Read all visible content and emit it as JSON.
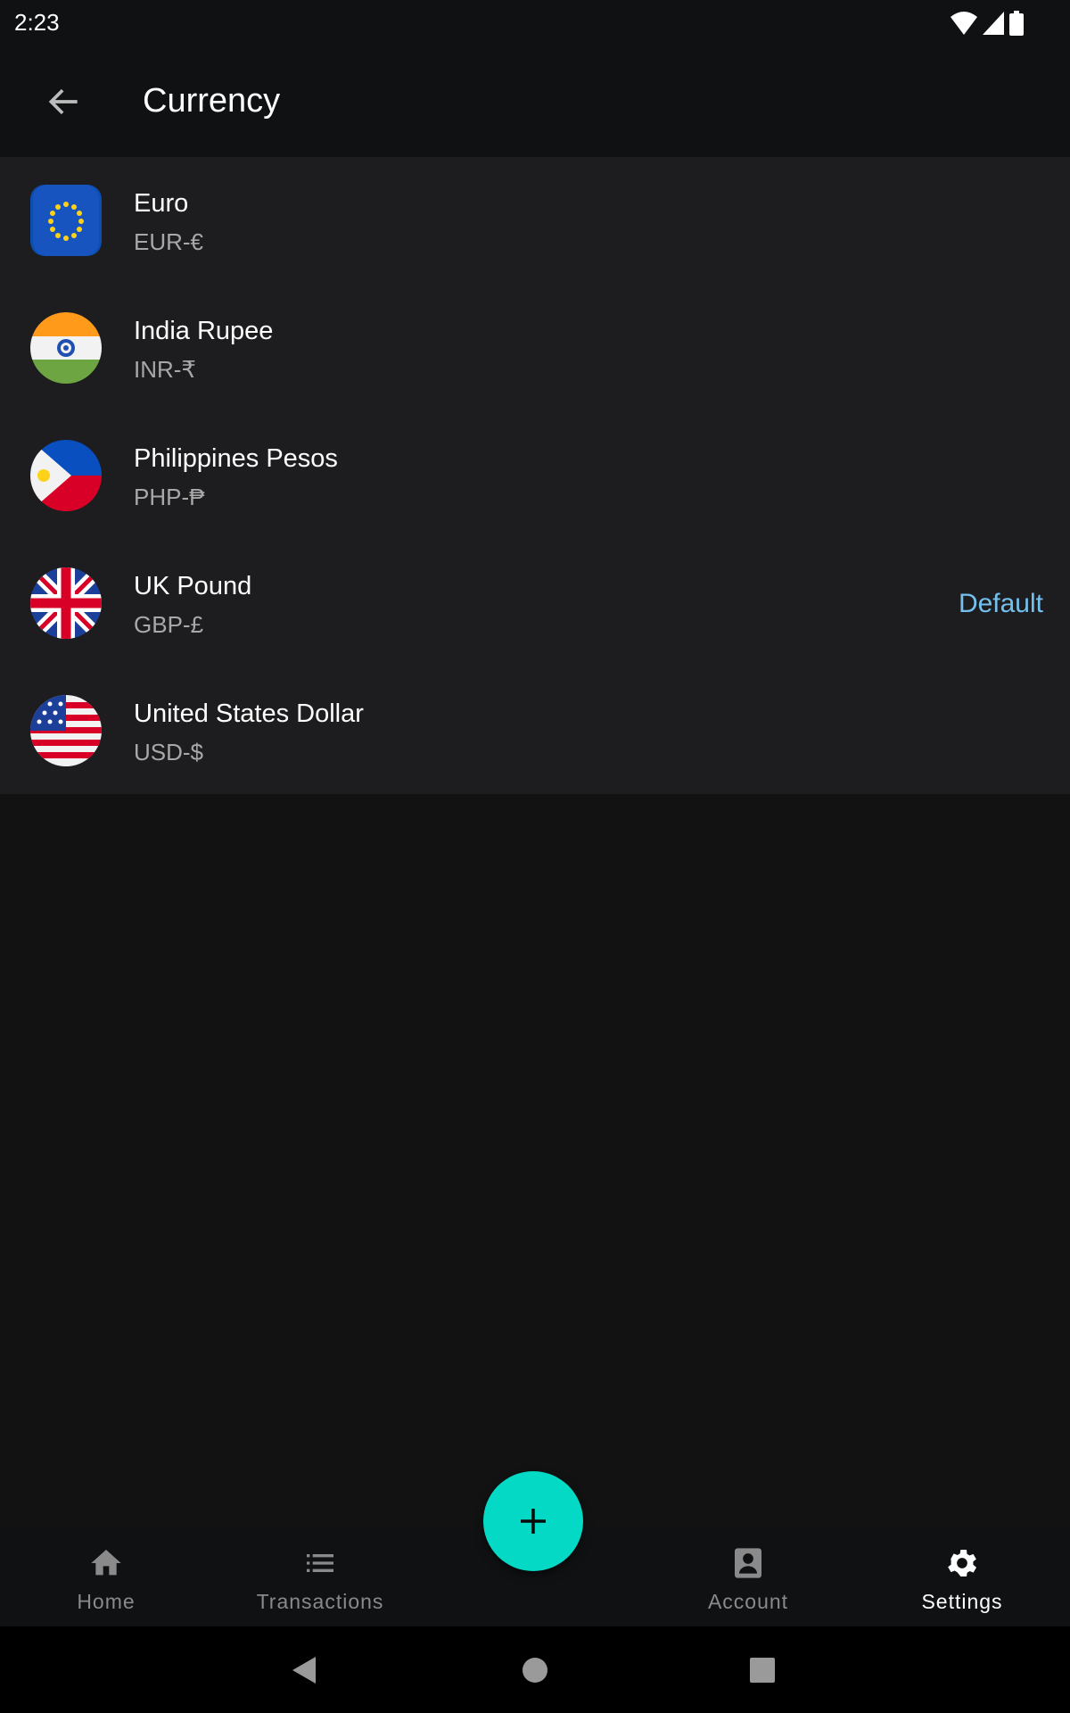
{
  "status_bar": {
    "time": "2:23",
    "icons": [
      "wifi-icon",
      "signal-icon",
      "battery-icon"
    ]
  },
  "app_bar": {
    "title": "Currency",
    "back_icon": "arrow-left-icon"
  },
  "currencies": [
    {
      "name": "Euro",
      "code": "EUR-€",
      "flag": "eu-flag"
    },
    {
      "name": "India Rupee",
      "code": "INR-₹",
      "flag": "india-flag"
    },
    {
      "name": "Philippines Pesos",
      "code": "PHP-₱",
      "flag": "philippines-flag"
    },
    {
      "name": "UK Pound",
      "code": "GBP-£",
      "flag": "uk-flag",
      "badge": "Default"
    },
    {
      "name": "United States Dollar",
      "code": "USD-$",
      "flag": "us-flag"
    }
  ],
  "bottom_nav": {
    "items": [
      {
        "label": "Home",
        "icon": "home-icon"
      },
      {
        "label": "Transactions",
        "icon": "list-icon"
      },
      {
        "label": "Account",
        "icon": "account-icon"
      },
      {
        "label": "Settings",
        "icon": "gear-icon",
        "active": true
      }
    ],
    "fab_icon": "plus-icon",
    "fab_color": "#03d9c5"
  },
  "colors": {
    "accent": "#03d9c5",
    "default_badge": "#74c1f0",
    "list_bg": "#1d1d1f",
    "bg": "#121212"
  }
}
